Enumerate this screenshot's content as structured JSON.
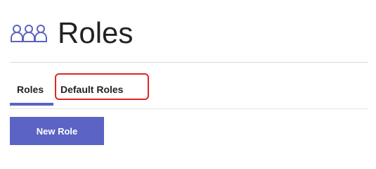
{
  "header": {
    "icon": "users-icon",
    "title": "Roles"
  },
  "tabs": [
    {
      "label": "Roles",
      "active": true
    },
    {
      "label": "Default Roles",
      "active": false,
      "highlighted": true
    }
  ],
  "actions": {
    "new_role_label": "New Role"
  },
  "colors": {
    "accent": "#5b63c4",
    "highlight": "#e02525",
    "icon": "#5b63c4"
  }
}
